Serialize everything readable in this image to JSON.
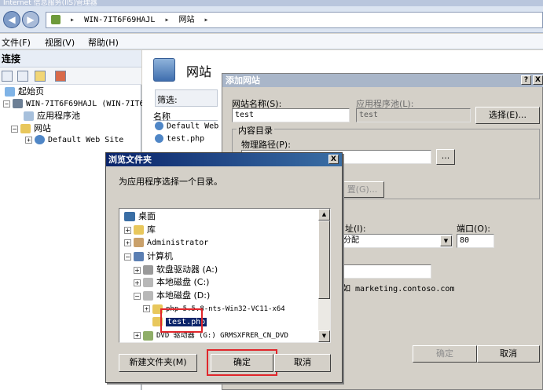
{
  "window": {
    "title": "Internet 信息服务(IIS)管理器"
  },
  "address": {
    "root": "WIN-7IT6F69HAJL",
    "site": "网站"
  },
  "menu": [
    "文件(F)",
    "视图(V)",
    "帮助(H)"
  ],
  "connections": {
    "header": "连接",
    "tree": {
      "start_page": "起始页",
      "server": "WIN-7IT6F69HAJL (WIN-7IT6F",
      "app_pools": "应用程序池",
      "sites": "网站",
      "default_site": "Default Web Site"
    }
  },
  "content": {
    "title": "网站",
    "filter_label": "筛选:",
    "col_name": "名称",
    "rows": [
      "Default Web",
      "test.php"
    ]
  },
  "add_site": {
    "title": "添加网站",
    "site_name_label": "网站名称(S):",
    "site_name_value": "test",
    "app_pool_label": "应用程序池(L):",
    "app_pool_value": "test",
    "select_button": "选择(E)...",
    "content_dir_label": "内容目录",
    "physical_path_label": "物理路径(P):",
    "browse_button": "...",
    "connect_as_partial": "置(G)...",
    "ip_label_partial": "址(I):",
    "ip_value_partial": "未分配",
    "port_label": "端口(O):",
    "port_value": "80",
    "example_partial": "如 marketing.contoso.com",
    "ok_button": "确定",
    "cancel_button": "取消",
    "help_button": "?",
    "close_button": "X"
  },
  "browse": {
    "title": "浏览文件夹",
    "close_button": "X",
    "instruction": "为应用程序选择一个目录。",
    "tree": {
      "desktop": "桌面",
      "library": "库",
      "administrator": "Administrator",
      "computer": "计算机",
      "floppy": "软盘驱动器 (A:)",
      "disk_c": "本地磁盘 (C:)",
      "disk_d": "本地磁盘 (D:)",
      "php_folder": "php-5.5.8-nts-Win32-VC11-x64",
      "selected_folder": "test.php",
      "dvd": "DVD 驱动器 (G:) GRMSXFRER_CN_DVD"
    },
    "new_folder_button": "新建文件夹(M)",
    "ok_button": "确定",
    "cancel_button": "取消",
    "highlight_color": "#e0262b"
  }
}
